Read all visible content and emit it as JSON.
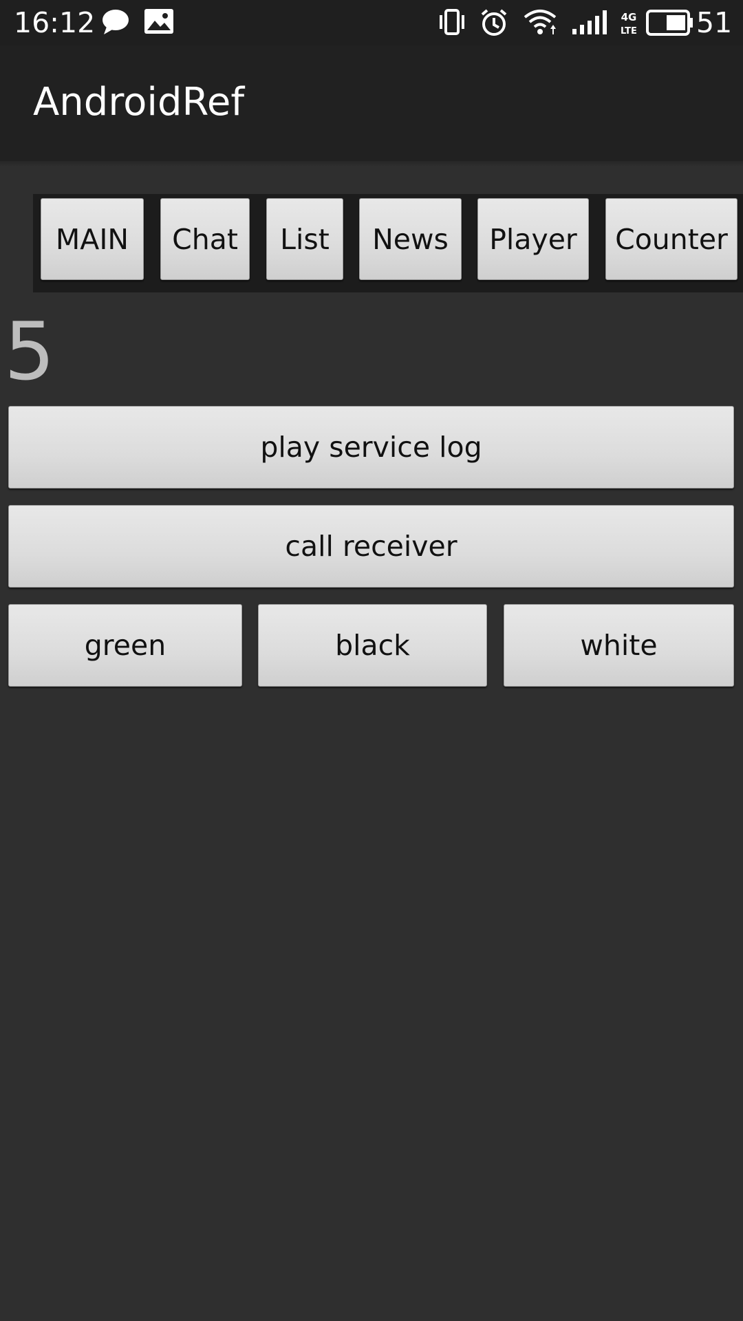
{
  "status_bar": {
    "time": "16:12",
    "battery_percent": "51",
    "network_label": "4G LTE",
    "icons": [
      "chat-bubble-icon",
      "image-icon",
      "vibrate-icon",
      "alarm-icon",
      "wifi-icon",
      "signal-icon",
      "network-4g-icon",
      "battery-icon"
    ]
  },
  "app": {
    "title": "AndroidRef"
  },
  "tabs": [
    {
      "label": "MAIN"
    },
    {
      "label": "Chat"
    },
    {
      "label": "List"
    },
    {
      "label": "News"
    },
    {
      "label": "Player"
    },
    {
      "label": "Counter"
    }
  ],
  "counter": {
    "value": "5"
  },
  "actions": {
    "play_service_log": "play service log",
    "call_receiver": "call receiver"
  },
  "color_buttons": [
    {
      "label": "green"
    },
    {
      "label": "black"
    },
    {
      "label": "white"
    }
  ],
  "colors": {
    "background": "#2f2f2f",
    "action_bar": "#212121",
    "status_bar": "#1f1f1f",
    "button_face": "#dcdcdc",
    "counter_text": "#bdbdbd"
  }
}
